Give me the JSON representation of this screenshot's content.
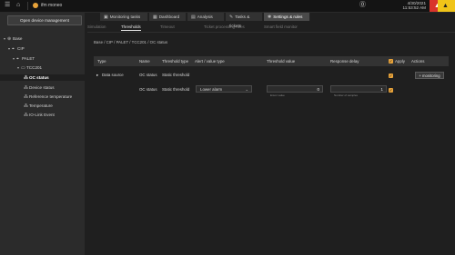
{
  "topbar": {
    "home_icon": "home-icon",
    "device_icon": "device-icon",
    "brand": "ifm moneo",
    "help_icon": "help-icon",
    "date": "4/30/2021",
    "time": "11:53:52 AM",
    "alarms": {
      "critical_color": "#d9342b",
      "warning_color": "#f0c419"
    }
  },
  "sidebar": {
    "management_button": "Open device management",
    "tree": [
      {
        "label": "Base",
        "icon": "globe-icon",
        "caret": "▾"
      },
      {
        "label": "CIP",
        "icon": "pin-icon",
        "caret": "▾"
      },
      {
        "label": "PALET",
        "icon": "pin-icon",
        "caret": "▾"
      },
      {
        "label": "TCC201",
        "icon": "sensor-icon",
        "caret": "▾"
      },
      {
        "label": "OC status",
        "icon": "data-icon",
        "caret": ""
      },
      {
        "label": "Device status",
        "icon": "data-icon",
        "caret": ""
      },
      {
        "label": "Reference temperature",
        "icon": "data-icon",
        "caret": ""
      },
      {
        "label": "Temperature",
        "icon": "data-icon",
        "caret": ""
      },
      {
        "label": "IO-Link Event",
        "icon": "data-icon",
        "caret": ""
      }
    ]
  },
  "tabs": [
    {
      "label": "Monitoring tasks",
      "icon": "monitor-icon"
    },
    {
      "label": "Dashboard",
      "icon": "dashboard-icon"
    },
    {
      "label": "Analysis",
      "icon": "analysis-icon"
    },
    {
      "label": "Tasks & tickets",
      "icon": "tasks-icon"
    },
    {
      "label": "Settings & rules",
      "icon": "settings-icon"
    }
  ],
  "subtabs": [
    "Simulation",
    "Thresholds",
    "Timeout",
    "Ticket processing rules",
    "Smart field monitor"
  ],
  "breadcrumb": "Base / CIP / PALET / TCC201 / OC status",
  "table": {
    "headers": [
      "Type",
      "Name",
      "Threshold type",
      "Alert / value type",
      "Threshold value",
      "Response delay",
      "Apply",
      "Actions"
    ],
    "row1": {
      "caret": "▸",
      "type": "Data source",
      "name": "OC status",
      "threshold_type": "Static threshold",
      "action": "monitoring"
    },
    "row2": {
      "name": "OC status",
      "threshold_type": "Static threshold",
      "alert_type": "Lower alarm",
      "threshold_value": "0",
      "threshold_unit": "Enum value",
      "response_delay": "1",
      "delay_unit": "Number of samples"
    }
  }
}
